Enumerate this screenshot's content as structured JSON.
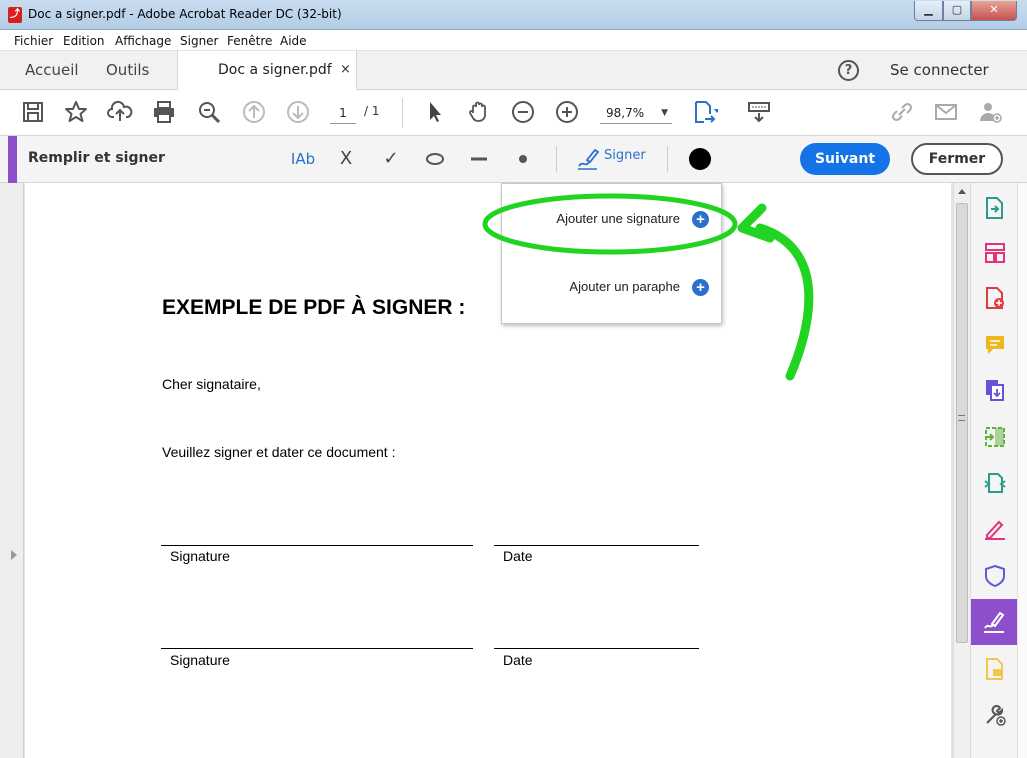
{
  "window": {
    "title": "Doc a signer.pdf - Adobe Acrobat Reader DC (32-bit)",
    "app_icon": "pdf-icon",
    "controls": [
      "minimize-icon",
      "maximize-icon",
      "close-icon"
    ]
  },
  "menu": [
    "Fichier",
    "Edition",
    "Affichage",
    "Signer",
    "Fenêtre",
    "Aide"
  ],
  "tabs": {
    "home": "Accueil",
    "tools": "Outils",
    "document": "Doc a signer.pdf",
    "close_tab": "×",
    "help": "?",
    "connect": "Se connecter"
  },
  "toolbar": {
    "page_current": "1",
    "page_total": "/ 1",
    "zoom": "98,7%",
    "icons": [
      "save-icon",
      "star-icon",
      "upload-icon",
      "print-icon",
      "search-zoom-icon",
      "page-up-icon",
      "page-down-icon",
      "select-arrow-icon",
      "hand-icon",
      "zoom-out-icon",
      "zoom-in-icon",
      "fit-page-icon",
      "keyboard-icon",
      "link-icon",
      "mail-icon",
      "add-user-icon"
    ]
  },
  "fill_sign": {
    "title": "Remplir et signer",
    "text_tool": "IAb",
    "cross_tool": "X",
    "check_tool": "✓",
    "sign_label": "Signer",
    "next_button": "Suivant",
    "close_button": "Fermer",
    "active_color": "#000000"
  },
  "dropdown": {
    "items": [
      {
        "label": "Ajouter une signature"
      },
      {
        "label": "Ajouter un paraphe"
      }
    ]
  },
  "document": {
    "heading": "EXEMPLE DE PDF À SIGNER :",
    "greeting": "Cher signataire,",
    "instruction": "Veuillez signer et dater ce document :",
    "fields": [
      {
        "signature": "Signature",
        "date": "Date"
      },
      {
        "signature": "Signature",
        "date": "Date"
      }
    ]
  },
  "right_panel": {
    "icons": [
      "create-pdf-icon",
      "organize-pages-icon",
      "export-pdf-icon",
      "comment-icon",
      "combine-files-icon",
      "edit-pdf-icon",
      "compress-pdf-icon",
      "fill-sign-pen-icon",
      "protect-shield-icon",
      "fill-sign-active-icon",
      "send-comments-icon",
      "more-tools-icon"
    ]
  },
  "colors": {
    "accent_purple": "#8e4fcc",
    "blue_primary": "#1473e6",
    "annotation_green": "#22d422"
  }
}
